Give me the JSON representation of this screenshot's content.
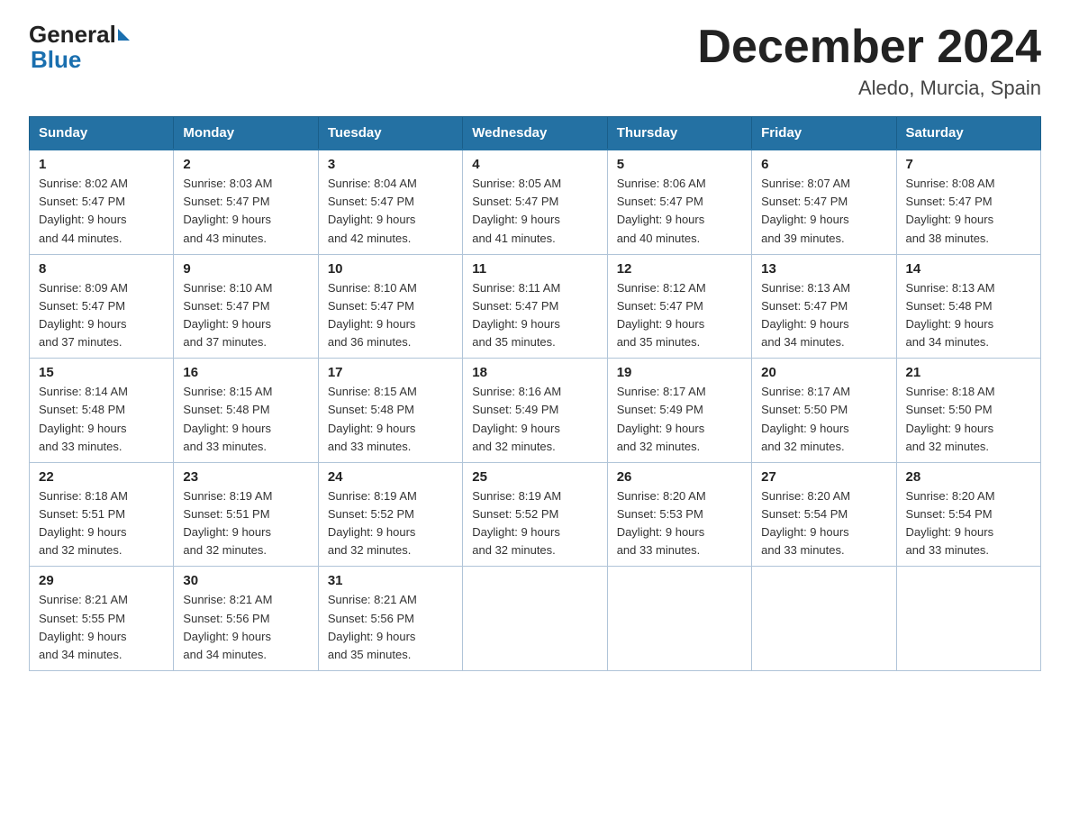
{
  "header": {
    "logo_general": "General",
    "logo_blue": "Blue",
    "title": "December 2024",
    "subtitle": "Aledo, Murcia, Spain"
  },
  "days_of_week": [
    "Sunday",
    "Monday",
    "Tuesday",
    "Wednesday",
    "Thursday",
    "Friday",
    "Saturday"
  ],
  "weeks": [
    [
      {
        "day": "1",
        "sunrise": "8:02 AM",
        "sunset": "5:47 PM",
        "daylight": "9 hours and 44 minutes."
      },
      {
        "day": "2",
        "sunrise": "8:03 AM",
        "sunset": "5:47 PM",
        "daylight": "9 hours and 43 minutes."
      },
      {
        "day": "3",
        "sunrise": "8:04 AM",
        "sunset": "5:47 PM",
        "daylight": "9 hours and 42 minutes."
      },
      {
        "day": "4",
        "sunrise": "8:05 AM",
        "sunset": "5:47 PM",
        "daylight": "9 hours and 41 minutes."
      },
      {
        "day": "5",
        "sunrise": "8:06 AM",
        "sunset": "5:47 PM",
        "daylight": "9 hours and 40 minutes."
      },
      {
        "day": "6",
        "sunrise": "8:07 AM",
        "sunset": "5:47 PM",
        "daylight": "9 hours and 39 minutes."
      },
      {
        "day": "7",
        "sunrise": "8:08 AM",
        "sunset": "5:47 PM",
        "daylight": "9 hours and 38 minutes."
      }
    ],
    [
      {
        "day": "8",
        "sunrise": "8:09 AM",
        "sunset": "5:47 PM",
        "daylight": "9 hours and 37 minutes."
      },
      {
        "day": "9",
        "sunrise": "8:10 AM",
        "sunset": "5:47 PM",
        "daylight": "9 hours and 37 minutes."
      },
      {
        "day": "10",
        "sunrise": "8:10 AM",
        "sunset": "5:47 PM",
        "daylight": "9 hours and 36 minutes."
      },
      {
        "day": "11",
        "sunrise": "8:11 AM",
        "sunset": "5:47 PM",
        "daylight": "9 hours and 35 minutes."
      },
      {
        "day": "12",
        "sunrise": "8:12 AM",
        "sunset": "5:47 PM",
        "daylight": "9 hours and 35 minutes."
      },
      {
        "day": "13",
        "sunrise": "8:13 AM",
        "sunset": "5:47 PM",
        "daylight": "9 hours and 34 minutes."
      },
      {
        "day": "14",
        "sunrise": "8:13 AM",
        "sunset": "5:48 PM",
        "daylight": "9 hours and 34 minutes."
      }
    ],
    [
      {
        "day": "15",
        "sunrise": "8:14 AM",
        "sunset": "5:48 PM",
        "daylight": "9 hours and 33 minutes."
      },
      {
        "day": "16",
        "sunrise": "8:15 AM",
        "sunset": "5:48 PM",
        "daylight": "9 hours and 33 minutes."
      },
      {
        "day": "17",
        "sunrise": "8:15 AM",
        "sunset": "5:48 PM",
        "daylight": "9 hours and 33 minutes."
      },
      {
        "day": "18",
        "sunrise": "8:16 AM",
        "sunset": "5:49 PM",
        "daylight": "9 hours and 32 minutes."
      },
      {
        "day": "19",
        "sunrise": "8:17 AM",
        "sunset": "5:49 PM",
        "daylight": "9 hours and 32 minutes."
      },
      {
        "day": "20",
        "sunrise": "8:17 AM",
        "sunset": "5:50 PM",
        "daylight": "9 hours and 32 minutes."
      },
      {
        "day": "21",
        "sunrise": "8:18 AM",
        "sunset": "5:50 PM",
        "daylight": "9 hours and 32 minutes."
      }
    ],
    [
      {
        "day": "22",
        "sunrise": "8:18 AM",
        "sunset": "5:51 PM",
        "daylight": "9 hours and 32 minutes."
      },
      {
        "day": "23",
        "sunrise": "8:19 AM",
        "sunset": "5:51 PM",
        "daylight": "9 hours and 32 minutes."
      },
      {
        "day": "24",
        "sunrise": "8:19 AM",
        "sunset": "5:52 PM",
        "daylight": "9 hours and 32 minutes."
      },
      {
        "day": "25",
        "sunrise": "8:19 AM",
        "sunset": "5:52 PM",
        "daylight": "9 hours and 32 minutes."
      },
      {
        "day": "26",
        "sunrise": "8:20 AM",
        "sunset": "5:53 PM",
        "daylight": "9 hours and 33 minutes."
      },
      {
        "day": "27",
        "sunrise": "8:20 AM",
        "sunset": "5:54 PM",
        "daylight": "9 hours and 33 minutes."
      },
      {
        "day": "28",
        "sunrise": "8:20 AM",
        "sunset": "5:54 PM",
        "daylight": "9 hours and 33 minutes."
      }
    ],
    [
      {
        "day": "29",
        "sunrise": "8:21 AM",
        "sunset": "5:55 PM",
        "daylight": "9 hours and 34 minutes."
      },
      {
        "day": "30",
        "sunrise": "8:21 AM",
        "sunset": "5:56 PM",
        "daylight": "9 hours and 34 minutes."
      },
      {
        "day": "31",
        "sunrise": "8:21 AM",
        "sunset": "5:56 PM",
        "daylight": "9 hours and 35 minutes."
      },
      null,
      null,
      null,
      null
    ]
  ],
  "labels": {
    "sunrise": "Sunrise:",
    "sunset": "Sunset:",
    "daylight": "Daylight:"
  }
}
